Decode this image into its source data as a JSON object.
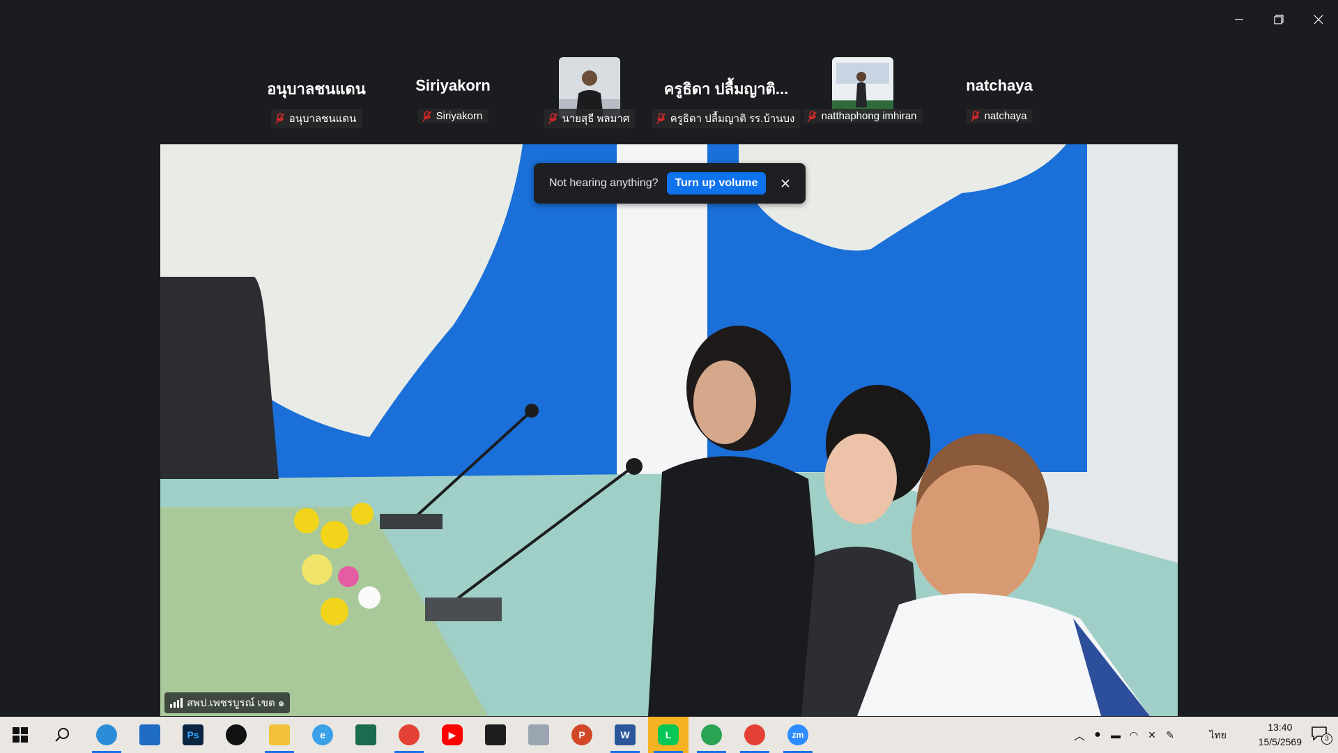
{
  "window_controls": {
    "minimize": "minimize",
    "restore": "restore",
    "close": "close"
  },
  "participants": [
    {
      "display_name": "อนุบาลชนแดน",
      "label": "อนุบาลชนแดน",
      "has_video": false
    },
    {
      "display_name": "Siriyakorn",
      "label": "Siriyakorn",
      "has_video": false
    },
    {
      "display_name": "",
      "label": "นายสุธี พลมาศ",
      "has_video": true
    },
    {
      "display_name": "ครูธิดา ปลื้มญาติ...",
      "label": "ครูธิดา ปลื้มญาติ รร.บ้านบง",
      "has_video": false
    },
    {
      "display_name": "",
      "label": "natthaphong imhiran",
      "has_video": true
    },
    {
      "display_name": "natchaya",
      "label": "natchaya",
      "has_video": false
    }
  ],
  "toast": {
    "message": "Not hearing anything?",
    "button": "Turn up volume"
  },
  "active_speaker": {
    "label": "สพป.เพชรบูรณ์ เขต ๑"
  },
  "taskbar": {
    "apps": [
      "windows-start",
      "search",
      "edge",
      "mail",
      "photoshop",
      "maps",
      "file-explorer",
      "internet-explorer",
      "app-green",
      "chrome",
      "youtube",
      "sticky-notes",
      "remote",
      "powerpoint",
      "word",
      "line",
      "chrome",
      "chrome",
      "zoom"
    ],
    "language": "ไทย",
    "time": "13:40",
    "date": "15/5/2569",
    "notification_count": "3"
  },
  "colors": {
    "accent": "#0e72ed",
    "mute": "#e02828",
    "background": "#1b1c20"
  }
}
